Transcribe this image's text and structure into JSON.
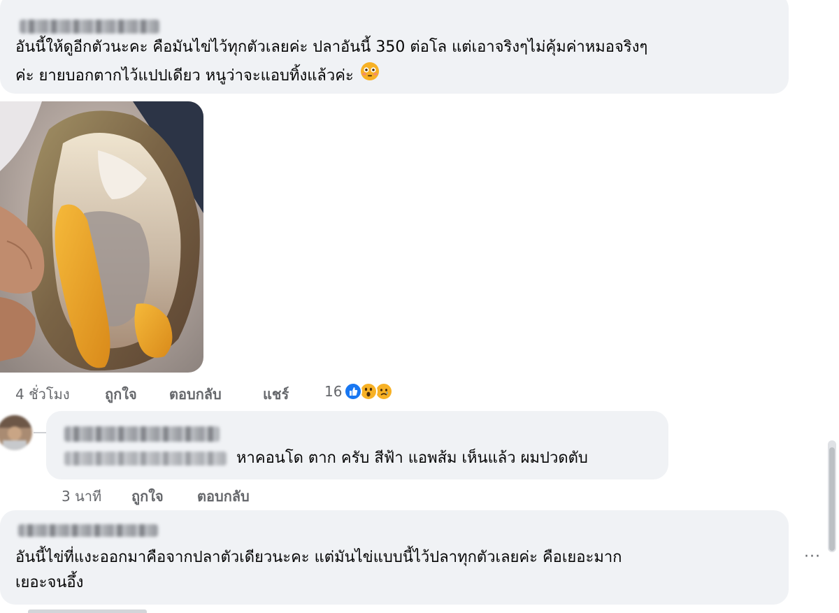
{
  "comments": [
    {
      "lines": [
        "อันนี้ให้ดูอีกตัวนะคะ คือมันไข่ไว้ทุกตัวเลยค่ะ ปลาอันนี้ 350 ต่อโล แต่เอาจริงๆไม่คุ้มค่าหมอจริงๆ",
        "ค่ะ ยายบอกตากไว้แปปเดียว หนูว่าจะแอบทิ้งแล้วค่ะ"
      ],
      "emoji_icon": "flushed-face-icon",
      "photo_icon": "dried-fish-with-roe-photo",
      "time": "4 ชั่วโมง",
      "like": "ถูกใจ",
      "reply": "ตอบกลับ",
      "share": "แชร์",
      "reaction_count": "16",
      "reaction_icons": [
        "like-reaction-icon",
        "wow-reaction-icon",
        "sad-reaction-icon"
      ]
    },
    {
      "text": "หาคอนโด ตาก ครับ สีฟ้า แอพส้ม เห็นแล้ว ผมปวดตับ",
      "time": "3 นาที",
      "like": "ถูกใจ",
      "reply": "ตอบกลับ"
    },
    {
      "lines": [
        "อันนี้ไข่ที่แงะออกมาคือจากปลาตัวเดียวนะคะ แต่มันไข่แบบนี้ไว้ปลาทุกตัวเลยค่ะ คือเยอะมาก",
        "เยอะจนอึ้ง"
      ]
    }
  ],
  "more_options": "···",
  "colors": {
    "bubble": "#f0f2f5",
    "meta_text": "#65676b",
    "like_blue": "#1877f2",
    "reaction_yellow": "#f7b125"
  }
}
